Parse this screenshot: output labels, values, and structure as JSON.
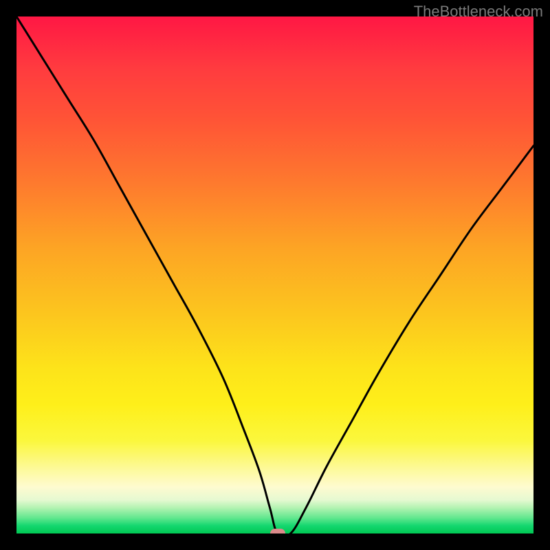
{
  "watermark": "TheBottleneck.com",
  "chart_data": {
    "type": "line",
    "title": "",
    "xlabel": "",
    "ylabel": "",
    "xlim": [
      0,
      100
    ],
    "ylim": [
      0,
      100
    ],
    "grid": false,
    "legend": false,
    "series": [
      {
        "name": "bottleneck-curve",
        "x": [
          0,
          5,
          10,
          15,
          20,
          25,
          30,
          35,
          40,
          44,
          47,
          49,
          50.5,
          53,
          56,
          60,
          65,
          70,
          76,
          82,
          88,
          94,
          100
        ],
        "y": [
          100,
          92,
          84,
          76,
          67,
          58,
          49,
          40,
          30,
          20,
          12,
          5,
          0,
          0,
          5,
          13,
          22,
          31,
          41,
          50,
          59,
          67,
          75
        ]
      }
    ],
    "marker": {
      "x": 50.5,
      "y": 0,
      "color": "#db8a8a"
    },
    "background": {
      "type": "vertical-gradient",
      "stops": [
        {
          "pos": 0,
          "color": "#ff1744"
        },
        {
          "pos": 0.45,
          "color": "#fda524"
        },
        {
          "pos": 0.75,
          "color": "#feef1a"
        },
        {
          "pos": 1.0,
          "color": "#00c853"
        }
      ]
    }
  }
}
